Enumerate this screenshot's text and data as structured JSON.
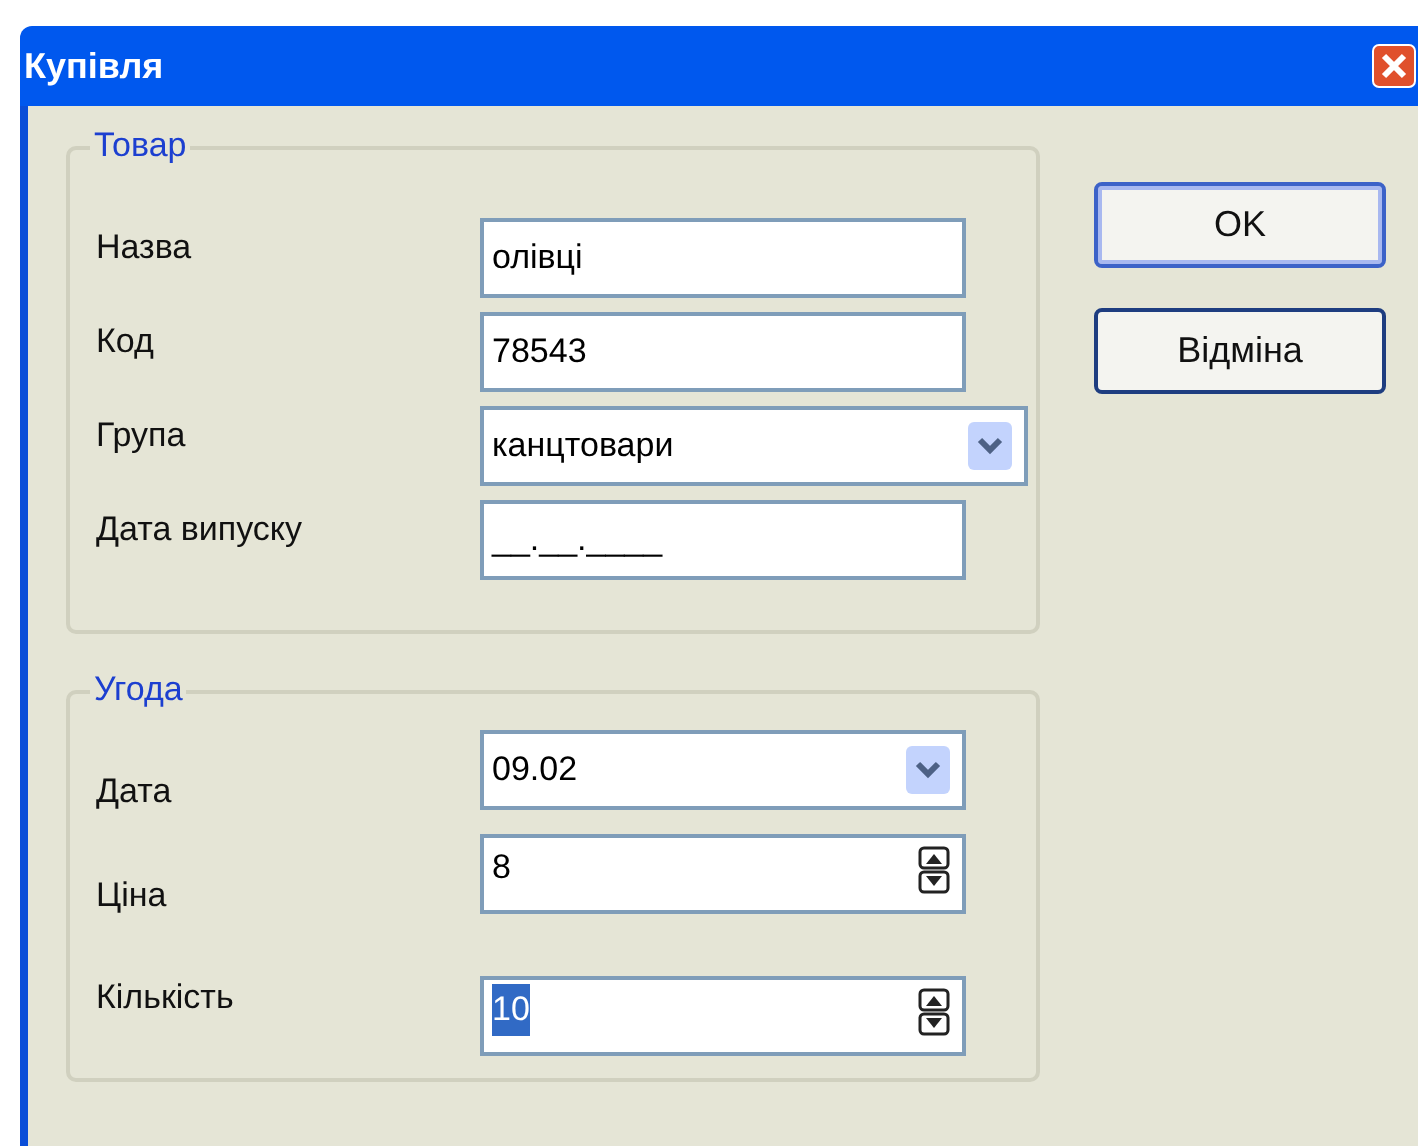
{
  "window": {
    "title": "Купівля"
  },
  "groups": [
    {
      "title": "Товар",
      "fields": [
        {
          "label": "Назва",
          "kind": "text",
          "value": "олівці"
        },
        {
          "label": "Код",
          "kind": "text",
          "value": "78543"
        },
        {
          "label": "Група",
          "kind": "combo",
          "value": "канцтовари"
        },
        {
          "label": "Дата випуску",
          "kind": "masked",
          "value": "__.__.____"
        }
      ]
    },
    {
      "title": "Угода",
      "fields": [
        {
          "label": "Дата",
          "kind": "date",
          "value": "09.02"
        },
        {
          "label": "Ціна",
          "kind": "spin",
          "value": "8",
          "text_selected": false
        },
        {
          "label": "Кількість",
          "kind": "spin",
          "value": "10",
          "text_selected": true
        }
      ]
    }
  ],
  "buttons": [
    {
      "label": "OK",
      "default": true
    },
    {
      "label": "Відміна",
      "default": false
    }
  ]
}
